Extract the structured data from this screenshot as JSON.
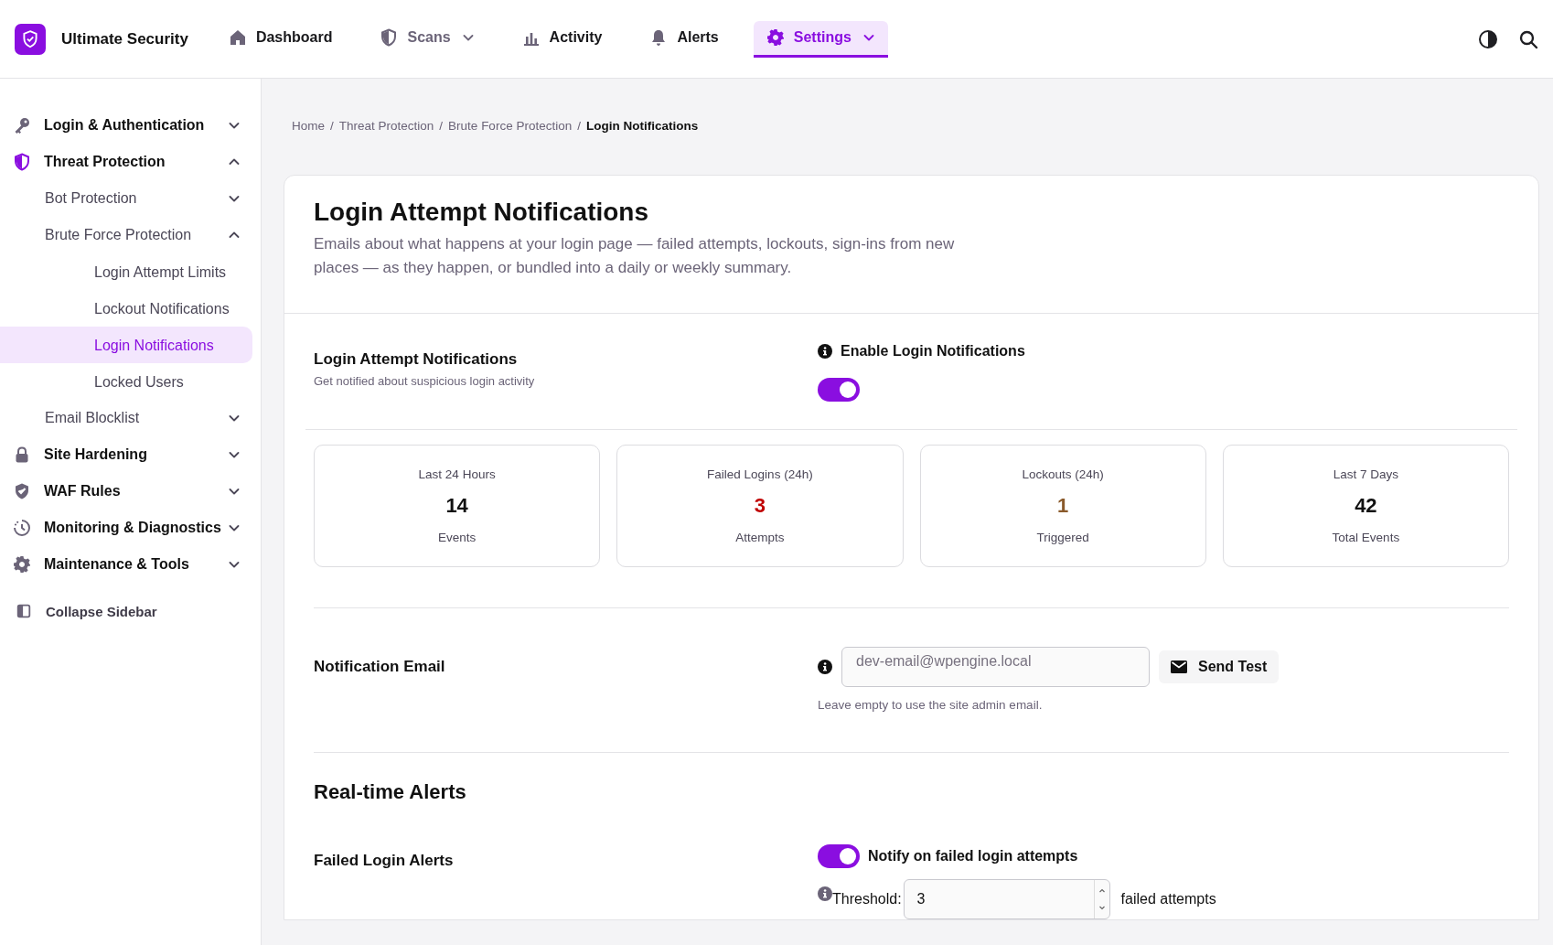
{
  "app": {
    "name": "Ultimate Security"
  },
  "nav": [
    {
      "label": "Dashboard",
      "selected": false,
      "dimmed": false,
      "has_menu": false
    },
    {
      "label": "Scans",
      "selected": false,
      "dimmed": true,
      "has_menu": true
    },
    {
      "label": "Activity",
      "selected": false,
      "dimmed": false,
      "has_menu": false
    },
    {
      "label": "Alerts",
      "selected": false,
      "dimmed": false,
      "has_menu": false
    },
    {
      "label": "Settings",
      "selected": true,
      "dimmed": false,
      "has_menu": true
    }
  ],
  "sidebar": {
    "items": [
      {
        "label": "Login & Authentication",
        "active": false,
        "expanded": false
      },
      {
        "label": "Threat Protection",
        "active": true,
        "expanded": true,
        "children": [
          {
            "label": "Bot Protection",
            "expanded": false
          },
          {
            "label": "Brute Force Protection",
            "expanded": true,
            "children": [
              {
                "label": "Login Attempt Limits",
                "selected": false
              },
              {
                "label": "Lockout Notifications",
                "selected": false
              },
              {
                "label": "Login Notifications",
                "selected": true
              },
              {
                "label": "Locked Users",
                "selected": false
              }
            ]
          },
          {
            "label": "Email Blocklist",
            "expanded": false
          }
        ]
      },
      {
        "label": "Site Hardening",
        "active": false,
        "expanded": false
      },
      {
        "label": "WAF Rules",
        "active": false,
        "expanded": false
      },
      {
        "label": "Monitoring & Diagnostics",
        "active": false,
        "expanded": false
      },
      {
        "label": "Maintenance & Tools",
        "active": false,
        "expanded": false
      }
    ],
    "collapse": "Collapse Sidebar"
  },
  "breadcrumb": [
    {
      "label": "Home",
      "current": false
    },
    {
      "separator": "/",
      "label": "Threat Protection",
      "current": false
    },
    {
      "separator": "/",
      "label": "Brute Force Protection",
      "current": false
    },
    {
      "separator": "/",
      "label": "Login Notifications",
      "current": true
    }
  ],
  "page": {
    "title": "Login Attempt Notifications",
    "description": "Emails about what happens at your login page — failed attempts, lockouts, sign-ins from new places — as they happen, or bundled into a daily or weekly summary.",
    "login_notifications": {
      "label": "Login Attempt Notifications",
      "hint": "Get notified about suspicious login activity",
      "toggle_label": "Enable Login Notifications",
      "on": true
    },
    "stats": [
      {
        "label": "Last 24 Hours",
        "value": "14",
        "caption": "Events",
        "color": "#111111"
      },
      {
        "label": "Failed Logins (24h)",
        "value": "3",
        "caption": "Attempts",
        "color": "#c00000"
      },
      {
        "label": "Lockouts (24h)",
        "value": "1",
        "caption": "Triggered",
        "color": "#8a5a2b"
      },
      {
        "label": "Last 7 Days",
        "value": "42",
        "caption": "Total Events",
        "color": "#111111"
      }
    ],
    "notification_email": {
      "label": "Notification Email",
      "placeholder": "dev-email@wpengine.local",
      "button": "Send Test",
      "help": "Leave empty to use the site admin email."
    },
    "realtime": {
      "heading": "Real-time Alerts",
      "label": "Failed Login Alerts",
      "toggle_label": "Notify on failed login attempts",
      "on": true,
      "threshold_label": "Threshold:",
      "threshold_value": "3",
      "threshold_unit": "failed attempts"
    }
  }
}
